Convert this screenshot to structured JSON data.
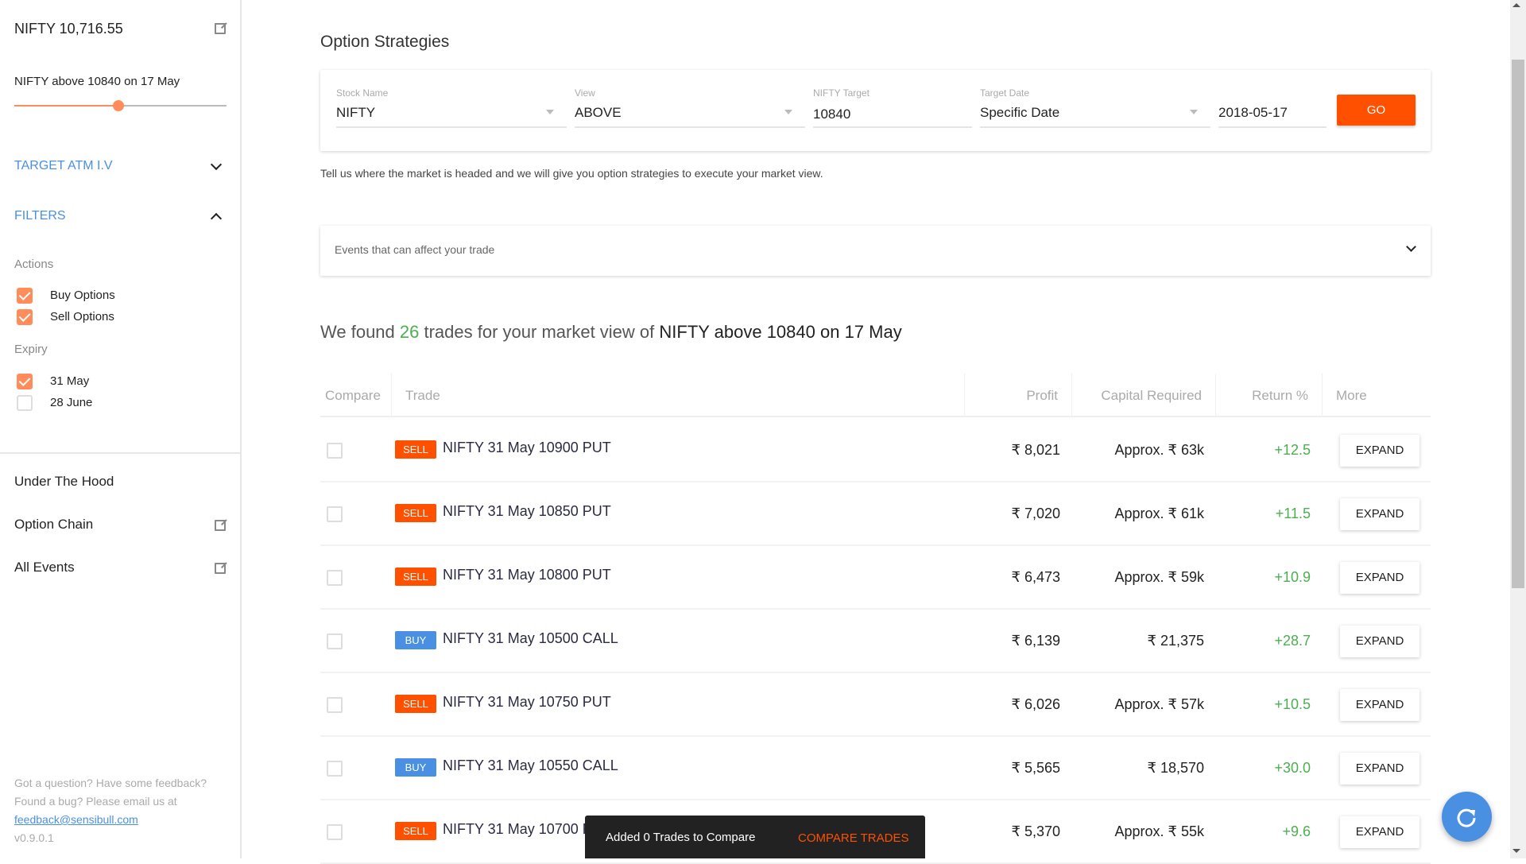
{
  "sidebar": {
    "index_title": "NIFTY 10,716.55",
    "market_view": "NIFTY above 10840 on 17 May",
    "slider_fraction": 0.49,
    "target_atm_iv": "TARGET ATM I.V",
    "filters": "FILTERS",
    "actions_label": "Actions",
    "actions": [
      {
        "label": "Buy Options",
        "checked": true
      },
      {
        "label": "Sell Options",
        "checked": true
      }
    ],
    "expiry_label": "Expiry",
    "expiry": [
      {
        "label": "31 May",
        "checked": true
      },
      {
        "label": "28 June",
        "checked": false
      }
    ],
    "links": [
      "Under The Hood",
      "Option Chain",
      "All Events"
    ],
    "footer_text": "Got a question? Have some feedback? Found a bug? Please email us at ",
    "footer_email": "feedback@sensibull.com",
    "version": "v0.9.0.1"
  },
  "main": {
    "title": "Option Strategies",
    "form": {
      "stock_label": "Stock Name",
      "stock_value": "NIFTY",
      "view_label": "View",
      "view_value": "ABOVE",
      "target_label": "NIFTY Target",
      "target_value": "10840",
      "date_label": "Target Date",
      "date_mode": "Specific Date",
      "date_value": "2018-05-17",
      "go": "GO"
    },
    "description": "Tell us where the market is headed and we will give you option strategies to execute your market view.",
    "events": "Events that can affect your trade",
    "found_prefix": "We found ",
    "found_count": "26",
    "found_mid": " trades for your market view of ",
    "found_view": "NIFTY above 10840 on 17 May",
    "columns": [
      "Compare",
      "Trade",
      "Profit",
      "Capital Required",
      "Return %",
      "More"
    ],
    "rows": [
      {
        "action": "SELL",
        "trade": "NIFTY 31 May 10900 PUT",
        "profit": "₹ 8,021",
        "capital": "Approx. ₹ 63k",
        "ret": "+12.5",
        "more": "EXPAND"
      },
      {
        "action": "SELL",
        "trade": "NIFTY 31 May 10850 PUT",
        "profit": "₹ 7,020",
        "capital": "Approx. ₹ 61k",
        "ret": "+11.5",
        "more": "EXPAND"
      },
      {
        "action": "SELL",
        "trade": "NIFTY 31 May 10800 PUT",
        "profit": "₹ 6,473",
        "capital": "Approx. ₹ 59k",
        "ret": "+10.9",
        "more": "EXPAND"
      },
      {
        "action": "BUY",
        "trade": "NIFTY 31 May 10500 CALL",
        "profit": "₹ 6,139",
        "capital": "₹ 21,375",
        "ret": "+28.7",
        "more": "EXPAND"
      },
      {
        "action": "SELL",
        "trade": "NIFTY 31 May 10750 PUT",
        "profit": "₹ 6,026",
        "capital": "Approx. ₹ 57k",
        "ret": "+10.5",
        "more": "EXPAND"
      },
      {
        "action": "BUY",
        "trade": "NIFTY 31 May 10550 CALL",
        "profit": "₹ 5,565",
        "capital": "₹ 18,570",
        "ret": "+30.0",
        "more": "EXPAND"
      },
      {
        "action": "SELL",
        "trade": "NIFTY 31 May 10700 PUT",
        "profit": "₹ 5,370",
        "capital": "Approx. ₹ 55k",
        "ret": "+9.6",
        "more": "EXPAND"
      }
    ],
    "toast": {
      "text": "Added 0 Trades to Compare",
      "action": "COMPARE TRADES"
    }
  },
  "colors": {
    "accent": "#ff5000",
    "buy": "#4a90e2",
    "positive": "#4caf50",
    "link": "#4a90e2"
  }
}
